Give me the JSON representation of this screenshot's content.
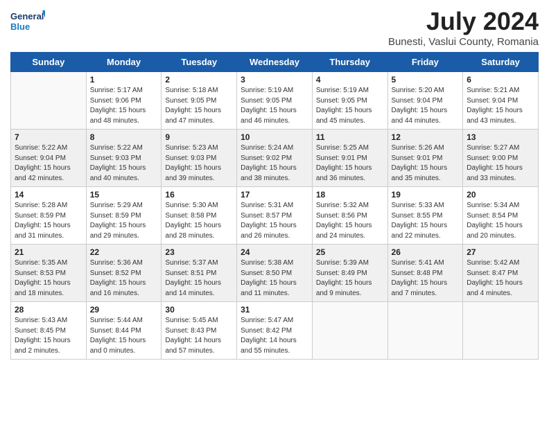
{
  "header": {
    "logo_line1": "General",
    "logo_line2": "Blue",
    "month": "July 2024",
    "location": "Bunesti, Vaslui County, Romania"
  },
  "weekdays": [
    "Sunday",
    "Monday",
    "Tuesday",
    "Wednesday",
    "Thursday",
    "Friday",
    "Saturday"
  ],
  "weeks": [
    [
      {
        "day": "",
        "info": ""
      },
      {
        "day": "1",
        "info": "Sunrise: 5:17 AM\nSunset: 9:06 PM\nDaylight: 15 hours\nand 48 minutes."
      },
      {
        "day": "2",
        "info": "Sunrise: 5:18 AM\nSunset: 9:05 PM\nDaylight: 15 hours\nand 47 minutes."
      },
      {
        "day": "3",
        "info": "Sunrise: 5:19 AM\nSunset: 9:05 PM\nDaylight: 15 hours\nand 46 minutes."
      },
      {
        "day": "4",
        "info": "Sunrise: 5:19 AM\nSunset: 9:05 PM\nDaylight: 15 hours\nand 45 minutes."
      },
      {
        "day": "5",
        "info": "Sunrise: 5:20 AM\nSunset: 9:04 PM\nDaylight: 15 hours\nand 44 minutes."
      },
      {
        "day": "6",
        "info": "Sunrise: 5:21 AM\nSunset: 9:04 PM\nDaylight: 15 hours\nand 43 minutes."
      }
    ],
    [
      {
        "day": "7",
        "info": "Sunrise: 5:22 AM\nSunset: 9:04 PM\nDaylight: 15 hours\nand 42 minutes."
      },
      {
        "day": "8",
        "info": "Sunrise: 5:22 AM\nSunset: 9:03 PM\nDaylight: 15 hours\nand 40 minutes."
      },
      {
        "day": "9",
        "info": "Sunrise: 5:23 AM\nSunset: 9:03 PM\nDaylight: 15 hours\nand 39 minutes."
      },
      {
        "day": "10",
        "info": "Sunrise: 5:24 AM\nSunset: 9:02 PM\nDaylight: 15 hours\nand 38 minutes."
      },
      {
        "day": "11",
        "info": "Sunrise: 5:25 AM\nSunset: 9:01 PM\nDaylight: 15 hours\nand 36 minutes."
      },
      {
        "day": "12",
        "info": "Sunrise: 5:26 AM\nSunset: 9:01 PM\nDaylight: 15 hours\nand 35 minutes."
      },
      {
        "day": "13",
        "info": "Sunrise: 5:27 AM\nSunset: 9:00 PM\nDaylight: 15 hours\nand 33 minutes."
      }
    ],
    [
      {
        "day": "14",
        "info": "Sunrise: 5:28 AM\nSunset: 8:59 PM\nDaylight: 15 hours\nand 31 minutes."
      },
      {
        "day": "15",
        "info": "Sunrise: 5:29 AM\nSunset: 8:59 PM\nDaylight: 15 hours\nand 29 minutes."
      },
      {
        "day": "16",
        "info": "Sunrise: 5:30 AM\nSunset: 8:58 PM\nDaylight: 15 hours\nand 28 minutes."
      },
      {
        "day": "17",
        "info": "Sunrise: 5:31 AM\nSunset: 8:57 PM\nDaylight: 15 hours\nand 26 minutes."
      },
      {
        "day": "18",
        "info": "Sunrise: 5:32 AM\nSunset: 8:56 PM\nDaylight: 15 hours\nand 24 minutes."
      },
      {
        "day": "19",
        "info": "Sunrise: 5:33 AM\nSunset: 8:55 PM\nDaylight: 15 hours\nand 22 minutes."
      },
      {
        "day": "20",
        "info": "Sunrise: 5:34 AM\nSunset: 8:54 PM\nDaylight: 15 hours\nand 20 minutes."
      }
    ],
    [
      {
        "day": "21",
        "info": "Sunrise: 5:35 AM\nSunset: 8:53 PM\nDaylight: 15 hours\nand 18 minutes."
      },
      {
        "day": "22",
        "info": "Sunrise: 5:36 AM\nSunset: 8:52 PM\nDaylight: 15 hours\nand 16 minutes."
      },
      {
        "day": "23",
        "info": "Sunrise: 5:37 AM\nSunset: 8:51 PM\nDaylight: 15 hours\nand 14 minutes."
      },
      {
        "day": "24",
        "info": "Sunrise: 5:38 AM\nSunset: 8:50 PM\nDaylight: 15 hours\nand 11 minutes."
      },
      {
        "day": "25",
        "info": "Sunrise: 5:39 AM\nSunset: 8:49 PM\nDaylight: 15 hours\nand 9 minutes."
      },
      {
        "day": "26",
        "info": "Sunrise: 5:41 AM\nSunset: 8:48 PM\nDaylight: 15 hours\nand 7 minutes."
      },
      {
        "day": "27",
        "info": "Sunrise: 5:42 AM\nSunset: 8:47 PM\nDaylight: 15 hours\nand 4 minutes."
      }
    ],
    [
      {
        "day": "28",
        "info": "Sunrise: 5:43 AM\nSunset: 8:45 PM\nDaylight: 15 hours\nand 2 minutes."
      },
      {
        "day": "29",
        "info": "Sunrise: 5:44 AM\nSunset: 8:44 PM\nDaylight: 15 hours\nand 0 minutes."
      },
      {
        "day": "30",
        "info": "Sunrise: 5:45 AM\nSunset: 8:43 PM\nDaylight: 14 hours\nand 57 minutes."
      },
      {
        "day": "31",
        "info": "Sunrise: 5:47 AM\nSunset: 8:42 PM\nDaylight: 14 hours\nand 55 minutes."
      },
      {
        "day": "",
        "info": ""
      },
      {
        "day": "",
        "info": ""
      },
      {
        "day": "",
        "info": ""
      }
    ]
  ]
}
